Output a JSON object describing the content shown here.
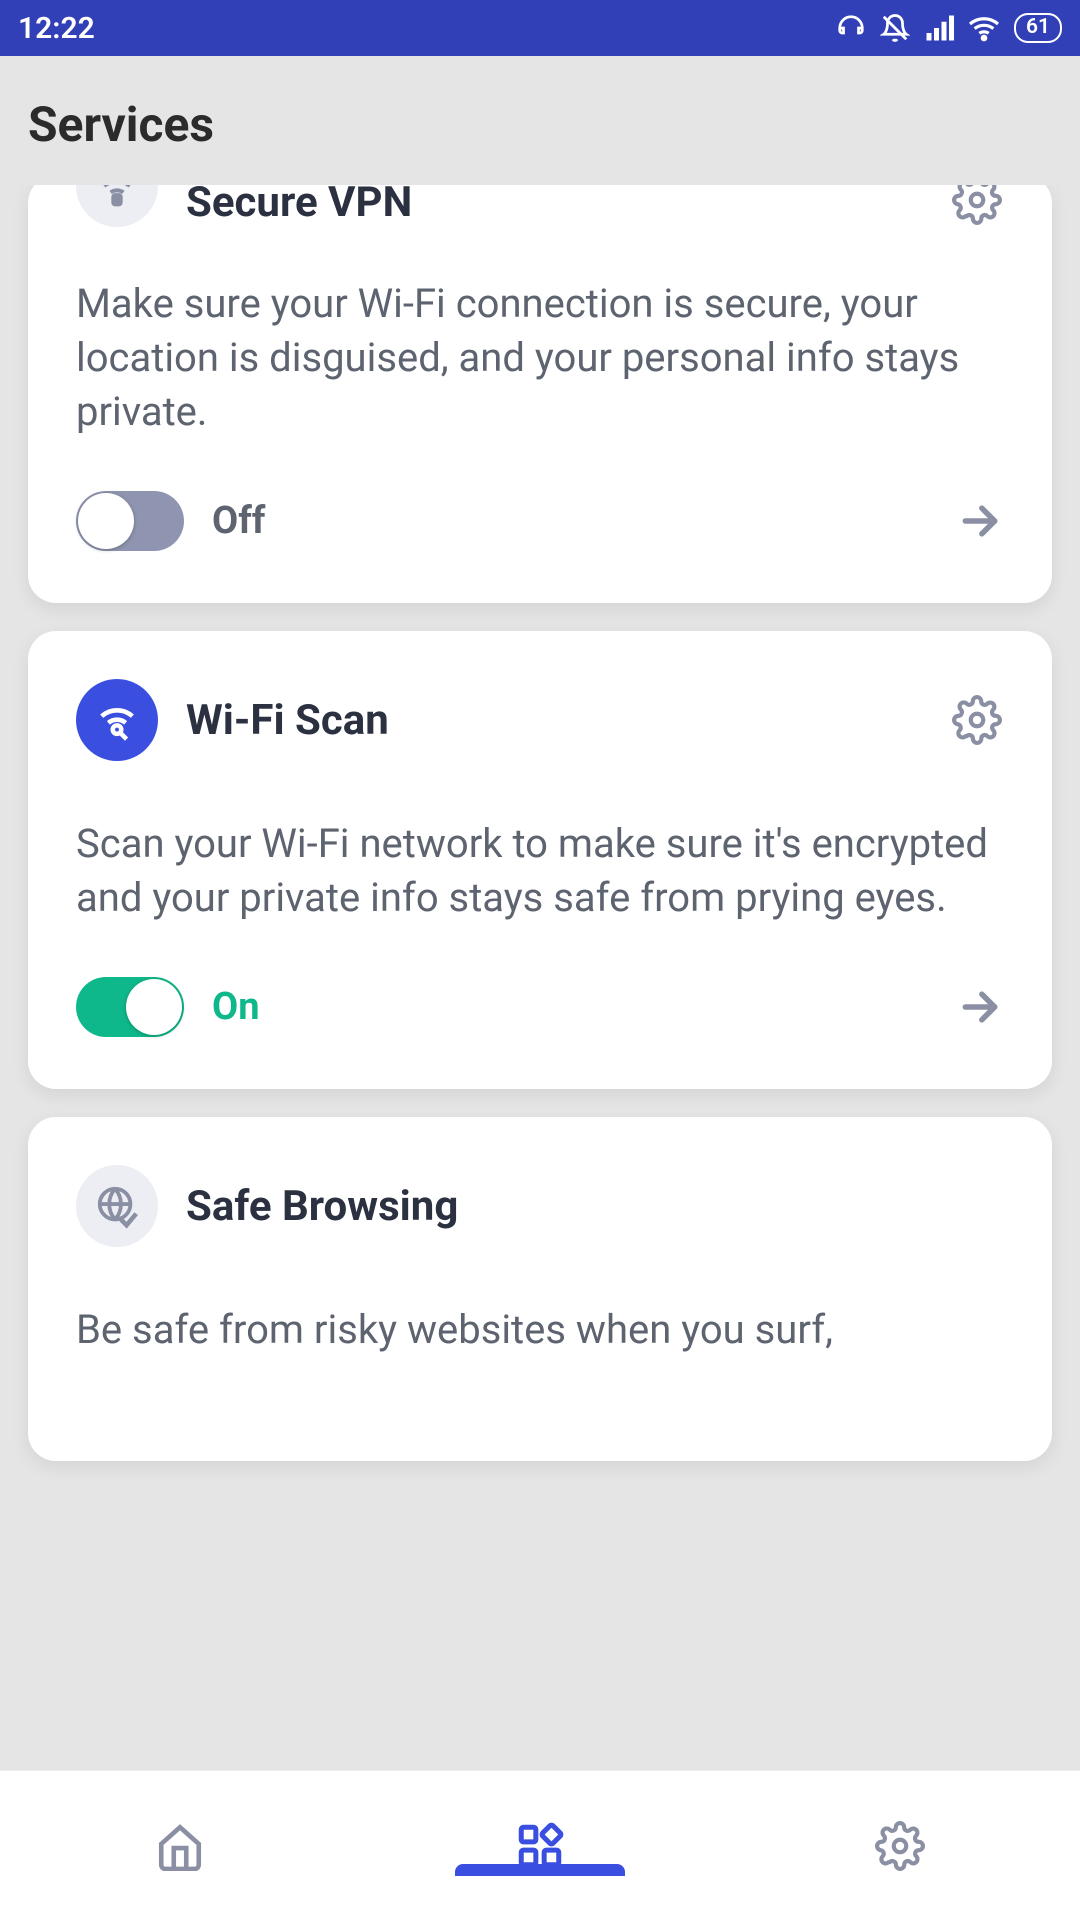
{
  "status": {
    "time": "12:22",
    "battery": "61"
  },
  "header": {
    "title": "Services"
  },
  "services": [
    {
      "id": "secure-vpn",
      "title": "Secure VPN",
      "desc": "Make sure your Wi-Fi connection is secure, your location is disguised, and your personal info stays private.",
      "toggle_state": "off",
      "toggle_label": "Off",
      "icon_bg": "grey"
    },
    {
      "id": "wifi-scan",
      "title": "Wi-Fi Scan",
      "desc": "Scan your Wi-Fi network to make sure it's encrypted and your private info stays safe from prying eyes.",
      "toggle_state": "on",
      "toggle_label": "On",
      "icon_bg": "blue"
    },
    {
      "id": "safe-browsing",
      "title": "Safe Browsing",
      "desc": "Be safe from risky websites when you surf,",
      "icon_bg": "grey"
    }
  ]
}
